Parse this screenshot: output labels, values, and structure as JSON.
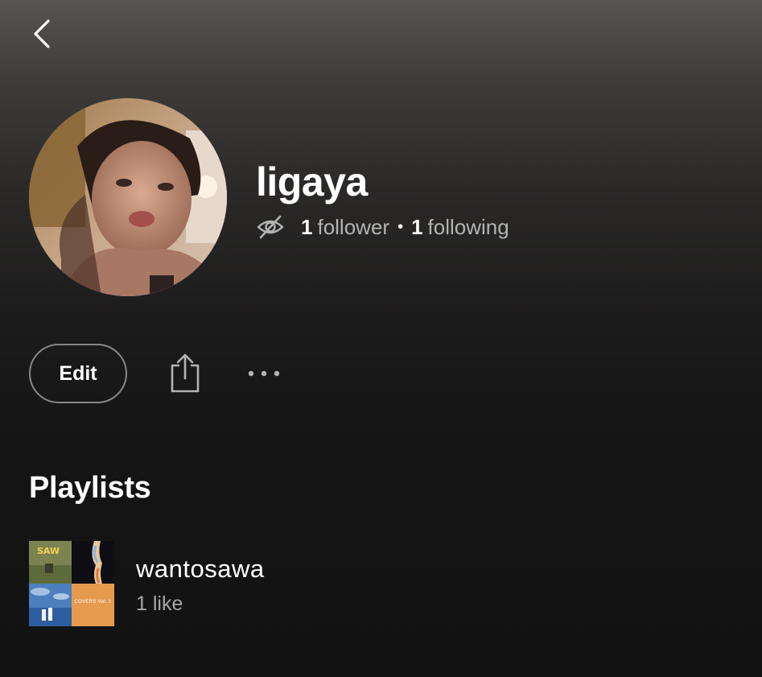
{
  "colors": {
    "background_top": "#575451",
    "background_bottom": "#121212",
    "text_primary": "#ffffff",
    "text_secondary": "#b3b3b3",
    "button_border": "#878787"
  },
  "header": {
    "back_icon": "chevron-left-icon"
  },
  "profile": {
    "avatar_icon": "profile-photo",
    "name": "ligaya",
    "privacy_icon": "eye-off-icon",
    "followers_count": "1",
    "followers_label": "follower",
    "separator": "•",
    "following_count": "1",
    "following_label": "following"
  },
  "actions": {
    "edit_label": "Edit",
    "share_icon": "share-icon",
    "more_icon": "more-horizontal-icon"
  },
  "playlists": {
    "section_title": "Playlists",
    "items": [
      {
        "name": "wantosawa",
        "meta": "1 like",
        "cover_text": "COVERS Vol. 1"
      }
    ]
  }
}
